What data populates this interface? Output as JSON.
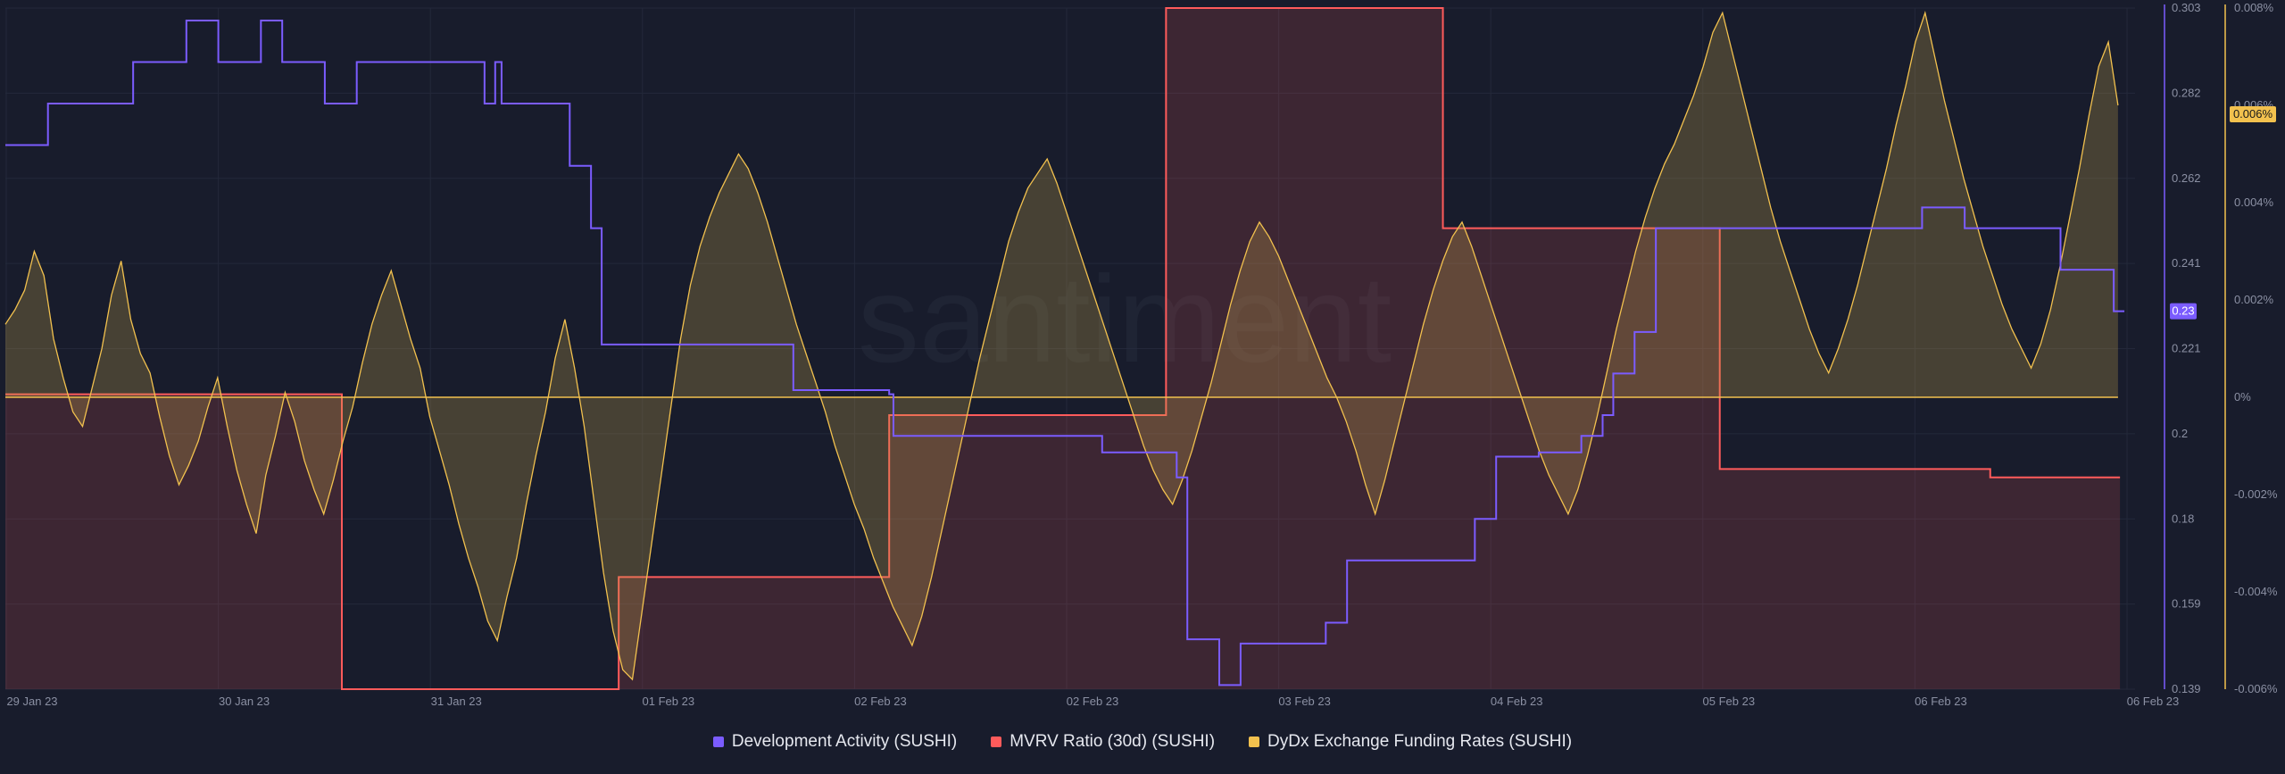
{
  "chart_data": {
    "type": "line",
    "watermark": "santiment",
    "x_labels": [
      "29 Jan 23",
      "30 Jan 23",
      "31 Jan 23",
      "01 Feb 23",
      "02 Feb 23",
      "02 Feb 23",
      "03 Feb 23",
      "04 Feb 23",
      "05 Feb 23",
      "06 Feb 23",
      "06 Feb 23"
    ],
    "left_axis": {
      "ticks": [
        "0.303",
        "0.282",
        "0.262",
        "0.241",
        "0.221",
        "0.2",
        "0.18",
        "0.159",
        "0.139"
      ],
      "min": 0.139,
      "max": 0.303
    },
    "right_axis": {
      "ticks": [
        "0.008%",
        "0.006%",
        "0.004%",
        "0.002%",
        "0%",
        "-0.002%",
        "-0.004%",
        "-0.006%"
      ],
      "min": -0.006,
      "max": 0.008
    },
    "series": [
      {
        "name": "Development Activity (SUSHI)",
        "color": "#7b5cff",
        "current_label": "0.23",
        "step": [
          [
            0,
            0.27
          ],
          [
            0.02,
            0.28
          ],
          [
            0.06,
            0.29
          ],
          [
            0.085,
            0.3
          ],
          [
            0.1,
            0.29
          ],
          [
            0.12,
            0.3
          ],
          [
            0.13,
            0.29
          ],
          [
            0.15,
            0.28
          ],
          [
            0.165,
            0.29
          ],
          [
            0.225,
            0.28
          ],
          [
            0.23,
            0.29
          ],
          [
            0.233,
            0.28
          ],
          [
            0.265,
            0.265
          ],
          [
            0.275,
            0.25
          ],
          [
            0.28,
            0.222
          ],
          [
            0.37,
            0.211
          ],
          [
            0.415,
            0.21
          ],
          [
            0.417,
            0.2
          ],
          [
            0.515,
            0.196
          ],
          [
            0.55,
            0.19
          ],
          [
            0.555,
            0.151
          ],
          [
            0.57,
            0.14
          ],
          [
            0.58,
            0.15
          ],
          [
            0.62,
            0.155
          ],
          [
            0.63,
            0.17
          ],
          [
            0.69,
            0.18
          ],
          [
            0.7,
            0.195
          ],
          [
            0.72,
            0.196
          ],
          [
            0.74,
            0.2
          ],
          [
            0.75,
            0.205
          ],
          [
            0.755,
            0.215
          ],
          [
            0.765,
            0.225
          ],
          [
            0.775,
            0.25
          ],
          [
            0.9,
            0.255
          ],
          [
            0.92,
            0.25
          ],
          [
            0.965,
            0.24
          ],
          [
            0.99,
            0.23
          ]
        ]
      },
      {
        "name": "MVRV Ratio (30d) (SUSHI)",
        "color": "#ff5b5b",
        "step": [
          [
            0,
            0.21
          ],
          [
            0.158,
            0.139
          ],
          [
            0.288,
            0.166
          ],
          [
            0.415,
            0.205
          ],
          [
            0.545,
            0.303
          ],
          [
            0.675,
            0.25
          ],
          [
            0.805,
            0.192
          ],
          [
            0.932,
            0.19
          ],
          [
            0.99,
            0.19
          ]
        ]
      },
      {
        "name": "DyDx Exchange Funding Rates (SUSHI)",
        "color": "#f2c14e",
        "current_label": "0.006%",
        "values": [
          0.0015,
          0.0018,
          0.0022,
          0.003,
          0.0025,
          0.0012,
          0.0004,
          -0.0003,
          -0.0006,
          0.0002,
          0.001,
          0.0021,
          0.0028,
          0.0016,
          0.0009,
          0.0005,
          -0.0004,
          -0.0012,
          -0.0018,
          -0.0014,
          -0.0009,
          -0.0002,
          0.0004,
          -0.0006,
          -0.0015,
          -0.0022,
          -0.0028,
          -0.0016,
          -0.0008,
          0.0001,
          -0.0005,
          -0.0013,
          -0.0019,
          -0.0024,
          -0.0017,
          -0.0009,
          -0.0002,
          0.0007,
          0.0015,
          0.0021,
          0.0026,
          0.0019,
          0.0012,
          0.0006,
          -0.0004,
          -0.0011,
          -0.0018,
          -0.0026,
          -0.0033,
          -0.0039,
          -0.0046,
          -0.005,
          -0.0041,
          -0.0033,
          -0.0022,
          -0.0012,
          -0.0003,
          0.0008,
          0.0016,
          0.0006,
          -0.0006,
          -0.0021,
          -0.0036,
          -0.0048,
          -0.0056,
          -0.0058,
          -0.0044,
          -0.003,
          -0.0016,
          -0.0002,
          0.0012,
          0.0023,
          0.0031,
          0.0037,
          0.0042,
          0.0046,
          0.005,
          0.0047,
          0.0042,
          0.0036,
          0.0029,
          0.0022,
          0.0015,
          0.0009,
          0.0003,
          -0.0003,
          -0.001,
          -0.0016,
          -0.0022,
          -0.0027,
          -0.0033,
          -0.0038,
          -0.0043,
          -0.0047,
          -0.0051,
          -0.0045,
          -0.0037,
          -0.0028,
          -0.0019,
          -0.001,
          -0.0001,
          0.0008,
          0.0016,
          0.0024,
          0.0032,
          0.0038,
          0.0043,
          0.0046,
          0.0049,
          0.0044,
          0.0038,
          0.0032,
          0.0026,
          0.002,
          0.0014,
          0.0008,
          0.0002,
          -0.0004,
          -0.001,
          -0.0015,
          -0.0019,
          -0.0022,
          -0.0017,
          -0.0011,
          -0.0004,
          0.0003,
          0.0011,
          0.0019,
          0.0026,
          0.0032,
          0.0036,
          0.0033,
          0.0029,
          0.0024,
          0.0019,
          0.0014,
          0.0009,
          0.0004,
          0,
          -0.0005,
          -0.0011,
          -0.0018,
          -0.0024,
          -0.0017,
          -0.0009,
          -0.0001,
          0.0007,
          0.0015,
          0.0022,
          0.0028,
          0.0033,
          0.0036,
          0.0031,
          0.0025,
          0.0019,
          0.0013,
          0.0007,
          0.0001,
          -0.0005,
          -0.0011,
          -0.0016,
          -0.002,
          -0.0024,
          -0.0019,
          -0.0012,
          -0.0004,
          0.0005,
          0.0014,
          0.0022,
          0.003,
          0.0037,
          0.0043,
          0.0048,
          0.0052,
          0.0057,
          0.0062,
          0.0068,
          0.0075,
          0.0079,
          0.0071,
          0.0063,
          0.0055,
          0.0047,
          0.0039,
          0.0032,
          0.0026,
          0.002,
          0.0014,
          0.0009,
          0.0005,
          0.001,
          0.0016,
          0.0023,
          0.0031,
          0.0039,
          0.0047,
          0.0056,
          0.0064,
          0.0073,
          0.0079,
          0.007,
          0.0061,
          0.0053,
          0.0045,
          0.0038,
          0.0031,
          0.0025,
          0.0019,
          0.0014,
          0.001,
          0.0006,
          0.0011,
          0.0018,
          0.0027,
          0.0037,
          0.0047,
          0.0058,
          0.0068,
          0.0073,
          0.006
        ]
      }
    ],
    "ylabel_left": "",
    "ylabel_right": ""
  },
  "legend": [
    {
      "label": "Development Activity (SUSHI)",
      "color": "#7b5cff"
    },
    {
      "label": "MVRV Ratio (30d) (SUSHI)",
      "color": "#ff5b5b"
    },
    {
      "label": "DyDx Exchange Funding Rates (SUSHI)",
      "color": "#f2c14e"
    }
  ]
}
